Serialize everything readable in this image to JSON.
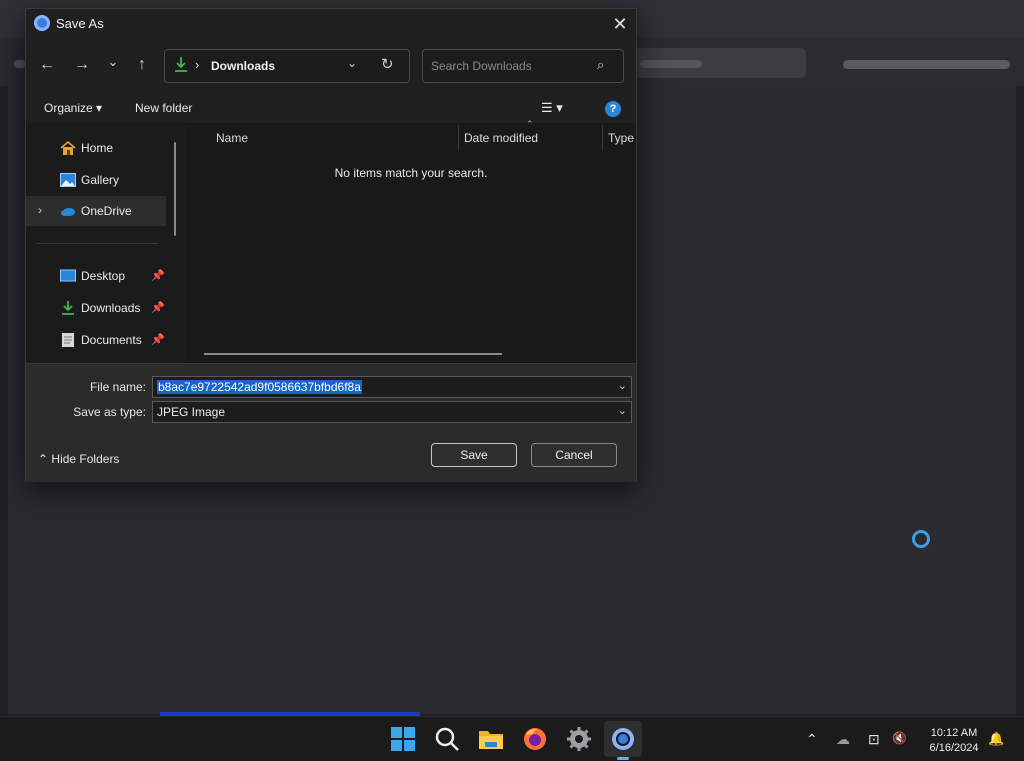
{
  "dialog": {
    "title": "Save As",
    "close_glyph": "✕",
    "nav": {
      "back_glyph": "←",
      "forward_glyph": "→",
      "recent_glyph": "⌄",
      "up_glyph": "↑"
    },
    "address": {
      "separator": "›",
      "location": "Downloads",
      "dropdown_glyph": "⌄",
      "refresh_glyph": "↻"
    },
    "search": {
      "placeholder": "Search Downloads",
      "icon_glyph": "⌕"
    },
    "toolbar": {
      "organize_label": "Organize ▾",
      "new_folder_label": "New folder",
      "view_glyph": "☰ ▾",
      "help_glyph": "?"
    },
    "nav_pane": {
      "items": [
        {
          "label": "Home",
          "icon": "home-icon"
        },
        {
          "label": "Gallery",
          "icon": "gallery-icon"
        },
        {
          "label": "OneDrive",
          "icon": "cloud-icon",
          "expand_glyph": "›",
          "selected": true
        },
        {
          "label": "Desktop",
          "icon": "desktop-icon",
          "pin_glyph": "📌"
        },
        {
          "label": "Downloads",
          "icon": "download-icon",
          "pin_glyph": "📌"
        },
        {
          "label": "Documents",
          "icon": "document-icon",
          "pin_glyph": "📌"
        }
      ]
    },
    "file_list": {
      "columns": [
        "Name",
        "Date modified",
        "Type"
      ],
      "sort_glyph": "⌃",
      "empty_message": "No items match your search."
    },
    "form": {
      "file_name_label": "File name:",
      "file_name_value": "b8ac7e9722542ad9f0586637bfbd6f8a",
      "save_type_label": "Save as type:",
      "save_type_value": "JPEG Image",
      "chevron_glyph": "⌄"
    },
    "buttons": {
      "save": "Save",
      "cancel": "Cancel"
    },
    "hide_folders_label": "Hide Folders",
    "hide_folders_glyph": "⌃"
  },
  "taskbar": {
    "apps": [
      "windows-start-icon",
      "search-icon",
      "file-explorer-icon",
      "firefox-icon",
      "settings-icon",
      "chrome-icon"
    ],
    "tray": {
      "chevron_glyph": "⌃",
      "onedrive_glyph": "☁",
      "network_glyph": "⊡",
      "volume_glyph": "🔇",
      "bell_glyph": "🔔"
    },
    "time": "10:12 AM",
    "date": "6/16/2024"
  },
  "colors": {
    "accent": "#2a86d8",
    "selection": "#1a64c8",
    "download_green": "#3fb950"
  }
}
